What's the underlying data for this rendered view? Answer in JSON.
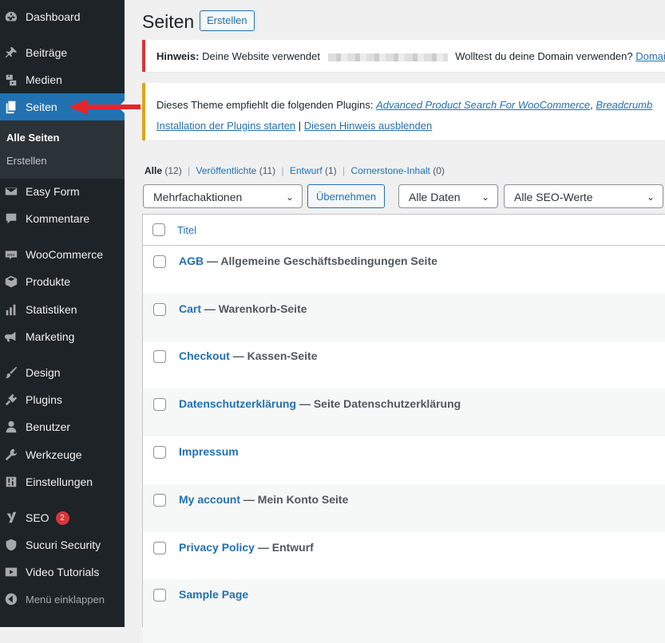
{
  "sidebar": {
    "items": [
      {
        "label": "Dashboard",
        "icon": "dashboard-icon"
      },
      {
        "label": "Beiträge",
        "icon": "pin-icon"
      },
      {
        "label": "Medien",
        "icon": "media-icon"
      },
      {
        "label": "Seiten",
        "icon": "pages-icon"
      },
      {
        "label": "Easy Form",
        "icon": "mail-icon"
      },
      {
        "label": "Kommentare",
        "icon": "comment-icon"
      },
      {
        "label": "WooCommerce",
        "icon": "woocommerce-icon"
      },
      {
        "label": "Produkte",
        "icon": "box-icon"
      },
      {
        "label": "Statistiken",
        "icon": "chart-icon"
      },
      {
        "label": "Marketing",
        "icon": "megaphone-icon"
      },
      {
        "label": "Design",
        "icon": "brush-icon"
      },
      {
        "label": "Plugins",
        "icon": "plug-icon"
      },
      {
        "label": "Benutzer",
        "icon": "user-icon"
      },
      {
        "label": "Werkzeuge",
        "icon": "wrench-icon"
      },
      {
        "label": "Einstellungen",
        "icon": "settings-icon"
      },
      {
        "label": "SEO",
        "icon": "yoast-icon",
        "badge": "2"
      },
      {
        "label": "Sucuri Security",
        "icon": "shield-icon"
      },
      {
        "label": "Video Tutorials",
        "icon": "video-icon"
      },
      {
        "label": "Menü einklappen",
        "icon": "collapse-icon"
      }
    ],
    "submenu": [
      "Alle Seiten",
      "Erstellen"
    ]
  },
  "header": {
    "title": "Seiten",
    "create_label": "Erstellen"
  },
  "notice1": {
    "strong": "Hinweis:",
    "text": "Deine Website verwendet",
    "text2": "Wolltest du deine Domain verwenden?",
    "link": "Domain"
  },
  "notice2": {
    "text": "Dieses Theme empfiehlt die folgenden Plugins:",
    "plugin1": "Advanced Product Search For WooCommerce",
    "sep": ",",
    "plugin2": "Breadcrumb",
    "link1": "Installation der Plugins starten",
    "divider": "|",
    "link2": "Diesen Hinweis ausblenden"
  },
  "filters": [
    {
      "label": "Alle",
      "count": "(12)"
    },
    {
      "label": "Veröffentlichte",
      "count": "(11)"
    },
    {
      "label": "Entwurf",
      "count": "(1)"
    },
    {
      "label": "Cornerstone-Inhalt",
      "count": "(0)"
    }
  ],
  "filter_sep": "|",
  "bulk": {
    "selected": "Mehrfachaktionen",
    "apply": "Übernehmen"
  },
  "date_filter": "Alle Daten",
  "seo_filter": "Alle SEO-Werte",
  "table": {
    "header_title": "Titel",
    "rows": [
      {
        "title": "AGB",
        "state": "— Allgemeine Geschäftsbedingungen Seite"
      },
      {
        "title": "Cart",
        "state": "— Warenkorb-Seite"
      },
      {
        "title": "Checkout",
        "state": "— Kassen-Seite"
      },
      {
        "title": "Datenschutzerklärung",
        "state": "— Seite Datenschutzerklärung"
      },
      {
        "title": "Impressum",
        "state": ""
      },
      {
        "title": "My account",
        "state": "— Mein Konto Seite"
      },
      {
        "title": "Privacy Policy",
        "state": "— Entwurf"
      },
      {
        "title": "Sample Page",
        "state": ""
      }
    ]
  },
  "colors": {
    "sidebar": "#1d2327",
    "accent": "#2271b1",
    "error": "#d63638",
    "warning": "#dba617",
    "arrow": "#e3262a"
  }
}
